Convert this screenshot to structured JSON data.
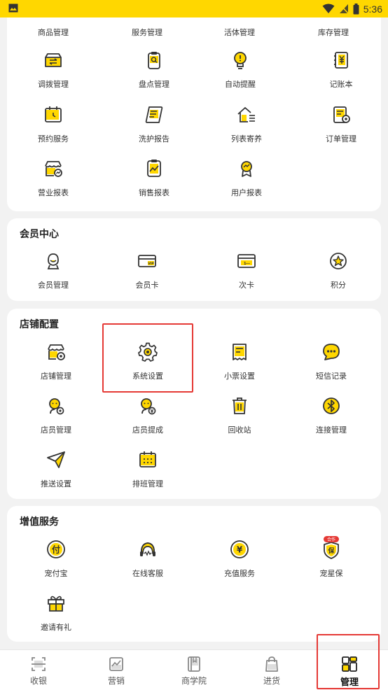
{
  "status_bar": {
    "time": "5:36"
  },
  "top_section": {
    "text_row": [
      {
        "label": "商品管理"
      },
      {
        "label": "服务管理"
      },
      {
        "label": "活体管理"
      },
      {
        "label": "库存管理"
      }
    ],
    "items": [
      {
        "label": "调拨管理",
        "icon": "transfer-box-icon"
      },
      {
        "label": "盘点管理",
        "icon": "inventory-check-icon"
      },
      {
        "label": "自动提醒",
        "icon": "bulb-alert-icon"
      },
      {
        "label": "记账本",
        "icon": "ledger-icon"
      },
      {
        "label": "预约服务",
        "icon": "calendar-clock-icon"
      },
      {
        "label": "洗护报告",
        "icon": "scroll-report-icon"
      },
      {
        "label": "列表寄养",
        "icon": "house-list-icon"
      },
      {
        "label": "订单管理",
        "icon": "order-gear-icon"
      },
      {
        "label": "营业报表",
        "icon": "store-chart-icon"
      },
      {
        "label": "销售报表",
        "icon": "sales-trend-icon"
      },
      {
        "label": "用户报表",
        "icon": "user-chart-icon"
      }
    ]
  },
  "member_center": {
    "title": "会员中心",
    "items": [
      {
        "label": "会员管理",
        "icon": "member-avatar-icon"
      },
      {
        "label": "会员卡",
        "icon": "vip-card-icon"
      },
      {
        "label": "次卡",
        "icon": "count-card-icon"
      },
      {
        "label": "积分",
        "icon": "star-points-icon"
      }
    ]
  },
  "store_config": {
    "title": "店铺配置",
    "items": [
      {
        "label": "店铺管理",
        "icon": "store-gear-icon"
      },
      {
        "label": "系统设置",
        "icon": "gear-icon"
      },
      {
        "label": "小票设置",
        "icon": "receipt-icon"
      },
      {
        "label": "短信记录",
        "icon": "chat-bubble-icon"
      },
      {
        "label": "店员管理",
        "icon": "staff-gear-icon"
      },
      {
        "label": "店员提成",
        "icon": "staff-commission-icon"
      },
      {
        "label": "回收站",
        "icon": "trash-icon"
      },
      {
        "label": "连接管理",
        "icon": "bluetooth-icon"
      },
      {
        "label": "推送设置",
        "icon": "paper-plane-icon"
      },
      {
        "label": "排班管理",
        "icon": "schedule-icon"
      }
    ]
  },
  "value_added": {
    "title": "增值服务",
    "items": [
      {
        "label": "宠付宝",
        "icon": "pay-coin-icon",
        "glyph": "付"
      },
      {
        "label": "在线客服",
        "icon": "headset-icon"
      },
      {
        "label": "充值服务",
        "icon": "yuan-coin-icon",
        "glyph": "¥"
      },
      {
        "label": "宠星保",
        "icon": "insurance-shield-icon",
        "glyph": "保",
        "badge": "合作"
      },
      {
        "label": "邀请有礼",
        "icon": "gift-icon"
      }
    ]
  },
  "tab_bar": {
    "tabs": [
      {
        "label": "收银",
        "icon": "cashier-icon"
      },
      {
        "label": "营销",
        "icon": "marketing-chart-icon"
      },
      {
        "label": "商学院",
        "icon": "book-icon"
      },
      {
        "label": "进货",
        "icon": "shopping-bag-icon"
      },
      {
        "label": "管理",
        "icon": "manage-grid-icon"
      }
    ],
    "active": "管理"
  },
  "colors": {
    "accent": "#ffd700",
    "icon_stroke": "#333333",
    "highlight": "#e53935",
    "badge": "#e53935"
  }
}
